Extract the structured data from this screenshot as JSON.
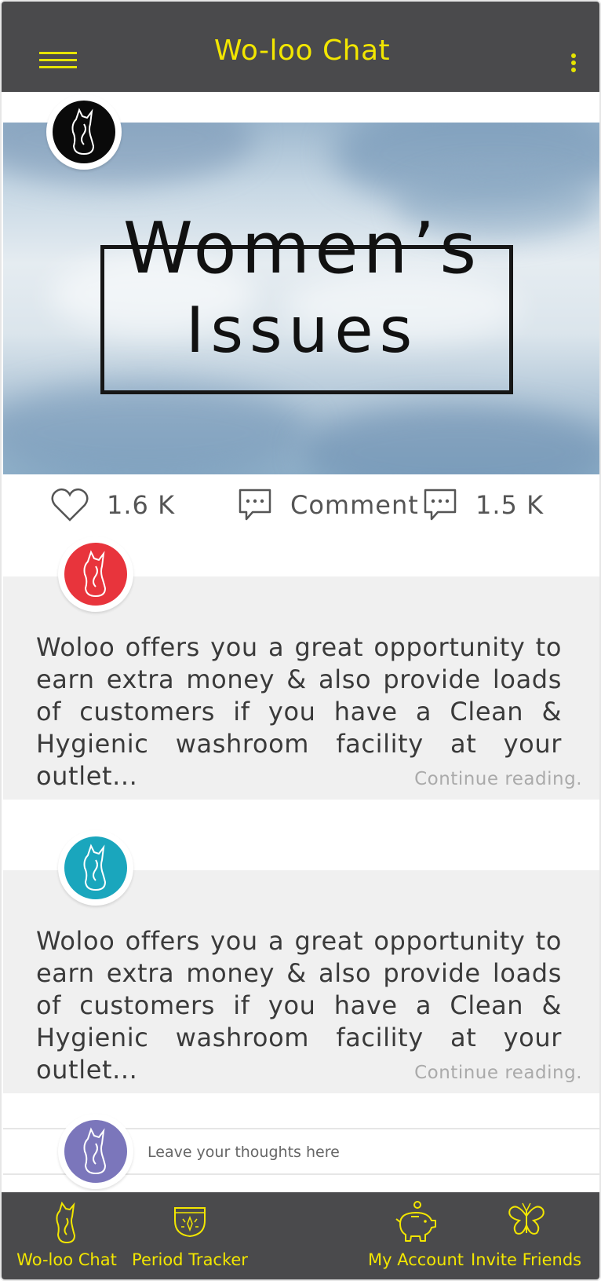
{
  "header": {
    "title": "Wo-loo Chat"
  },
  "hero": {
    "line1": "Women’s",
    "line2": "Issues"
  },
  "actions": {
    "likes": "1.6 K",
    "comment_label": "Comment",
    "comments": "1.5 K"
  },
  "posts": [
    {
      "text": "Woloo offers you a great opportunity to earn extra money & also provide loads of customers if you have a Clean & Hygienic washroom facility at your outlet...",
      "more": "Continue reading."
    },
    {
      "text": "Woloo offers you a great opportunity to earn extra money & also provide loads of customers if you have a Clean & Hygienic washroom facility at your outlet...",
      "more": "Continue reading."
    }
  ],
  "thought": {
    "placeholder": "Leave your thoughts here"
  },
  "nav": {
    "items": [
      {
        "label": "Wo-loo Chat",
        "icon": "cat-icon"
      },
      {
        "label": "Period Tracker",
        "icon": "period-icon"
      },
      {
        "label": "My Account",
        "icon": "piggy-bank-icon"
      },
      {
        "label": "Invite Friends",
        "icon": "butterfly-icon"
      }
    ]
  },
  "colors": {
    "bar": "#4a4a4c",
    "accent": "#f2e600",
    "avatar_black": "#0a0a0a",
    "avatar_red": "#e8343c",
    "avatar_teal": "#1aa6bd",
    "avatar_purple": "#7b76bb"
  }
}
